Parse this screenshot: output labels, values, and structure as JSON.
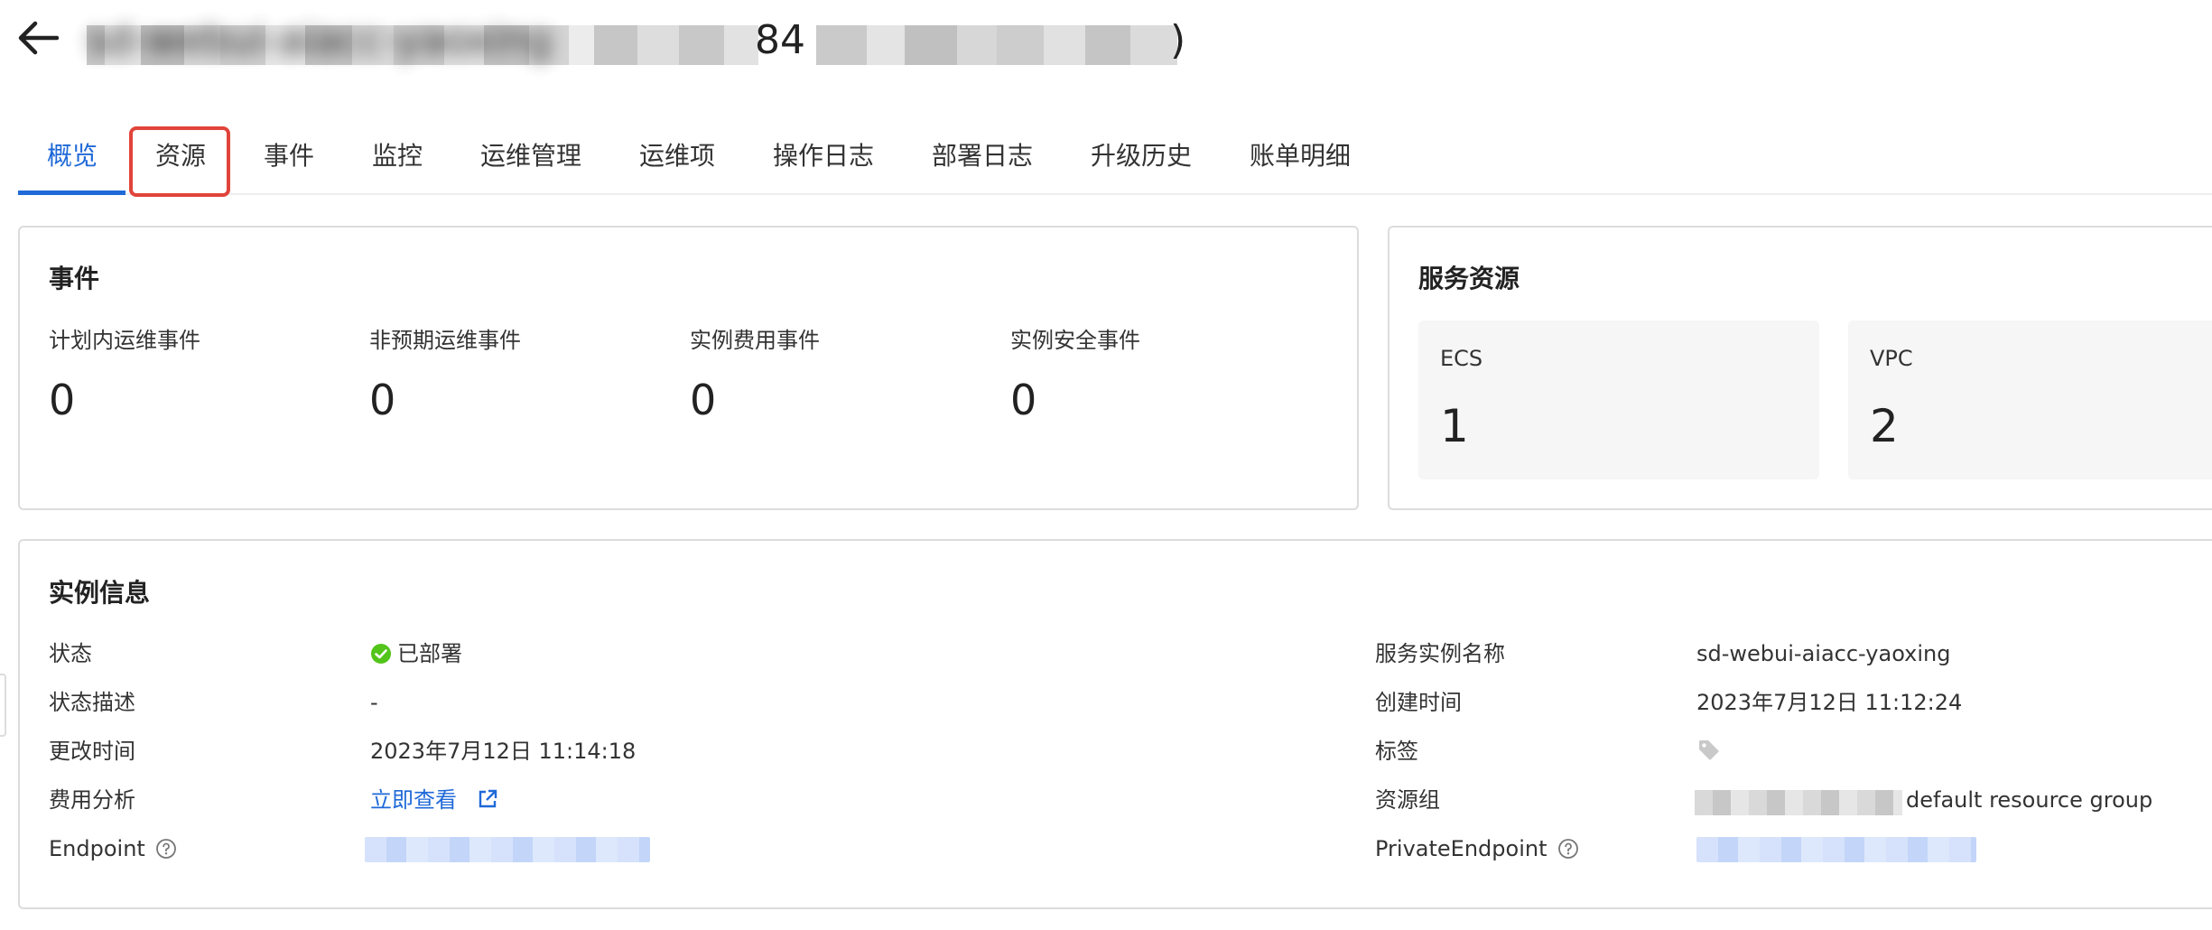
{
  "header": {
    "title_redacted": "sd-webui-aiacc-yaoxing",
    "title_visible_fragment": "84",
    "title_visible_tail": ")"
  },
  "tabs": [
    {
      "label": "概览",
      "active": true
    },
    {
      "label": "资源",
      "highlighted": true
    },
    {
      "label": "事件"
    },
    {
      "label": "监控"
    },
    {
      "label": "运维管理"
    },
    {
      "label": "运维项"
    },
    {
      "label": "操作日志"
    },
    {
      "label": "部署日志"
    },
    {
      "label": "升级历史"
    },
    {
      "label": "账单明细"
    }
  ],
  "events": {
    "title": "事件",
    "items": [
      {
        "label": "计划内运维事件",
        "value": "0"
      },
      {
        "label": "非预期运维事件",
        "value": "0"
      },
      {
        "label": "实例费用事件",
        "value": "0"
      },
      {
        "label": "实例安全事件",
        "value": "0"
      }
    ]
  },
  "resources": {
    "title": "服务资源",
    "items": [
      {
        "label": "ECS",
        "value": "1"
      },
      {
        "label": "VPC",
        "value": "2"
      }
    ]
  },
  "instance": {
    "title": "实例信息",
    "left": [
      {
        "key": "状态",
        "value": "已部署",
        "status": "success"
      },
      {
        "key": "状态描述",
        "value": "-"
      },
      {
        "key": "更改时间",
        "value": "2023年7月12日 11:14:18"
      },
      {
        "key": "费用分析",
        "value": "立即查看",
        "link": true
      },
      {
        "key": "Endpoint",
        "value": "",
        "redacted": true
      }
    ],
    "right": [
      {
        "key": "服务实例名称",
        "value": "sd-webui-aiacc-yaoxing"
      },
      {
        "key": "创建时间",
        "value": "2023年7月12日 11:12:24"
      },
      {
        "key": "标签",
        "value": ""
      },
      {
        "key": "资源组",
        "value": "default resource group",
        "redacted_prefix": true
      },
      {
        "key": "PrivateEndpoint",
        "value": "",
        "redacted": true
      }
    ]
  },
  "colors": {
    "accent": "#1f69d8",
    "success": "#52c41a",
    "highlight_box": "#e0443a"
  },
  "icons": {
    "back": "arrow-left-icon",
    "status": "check-circle-icon",
    "external": "external-link-icon",
    "help": "question-circle-icon",
    "tag": "tag-icon"
  }
}
